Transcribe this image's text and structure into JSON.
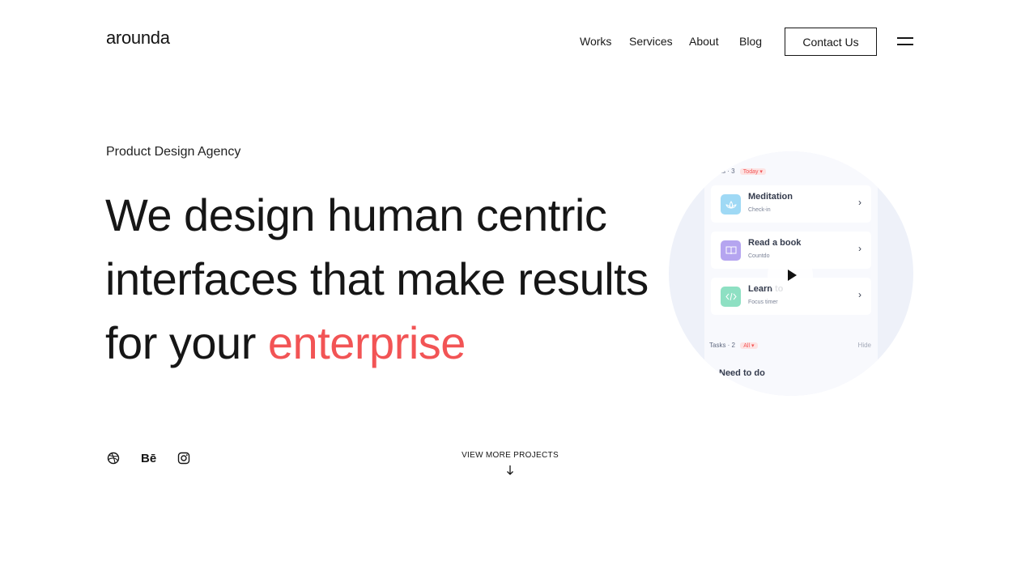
{
  "brand": {
    "logo_text": "arounda"
  },
  "nav": {
    "links": [
      "Works",
      "Services",
      "About",
      "Blog"
    ],
    "contact_label": "Contact Us",
    "menu_icon": "hamburger-menu-icon"
  },
  "hero": {
    "eyebrow": "Product Design Agency",
    "headline_line1": "We design human centric",
    "headline_line2": "interfaces that make results",
    "headline_line3_prefix": "for your ",
    "headline_accent": "enterprise"
  },
  "preview": {
    "habits_header": "its · 3",
    "today_chip": "Today ▾",
    "cards": [
      {
        "title": "Meditation",
        "subtitle": "Check-in",
        "icon": "lotus-icon"
      },
      {
        "title": "Read a book",
        "subtitle": "Countdo",
        "icon": "book-icon"
      },
      {
        "title": "Learn to",
        "subtitle": "Focus timer",
        "icon": "code-icon"
      }
    ],
    "tasks_header": "Tasks · 2",
    "all_chip": "All ▾",
    "hide_label": "Hide",
    "need_to_do": "Need to do",
    "play_icon": "play-icon"
  },
  "social": {
    "icons": [
      "dribbble-icon",
      "behance-icon",
      "instagram-icon"
    ],
    "behance_text": "Bē"
  },
  "footer_cta": {
    "view_more": "VIEW MORE PROJECTS",
    "arrow_icon": "arrow-down-icon"
  },
  "colors": {
    "accent": "#f25455",
    "text": "#161616",
    "preview_bg": "#eef1f9"
  }
}
